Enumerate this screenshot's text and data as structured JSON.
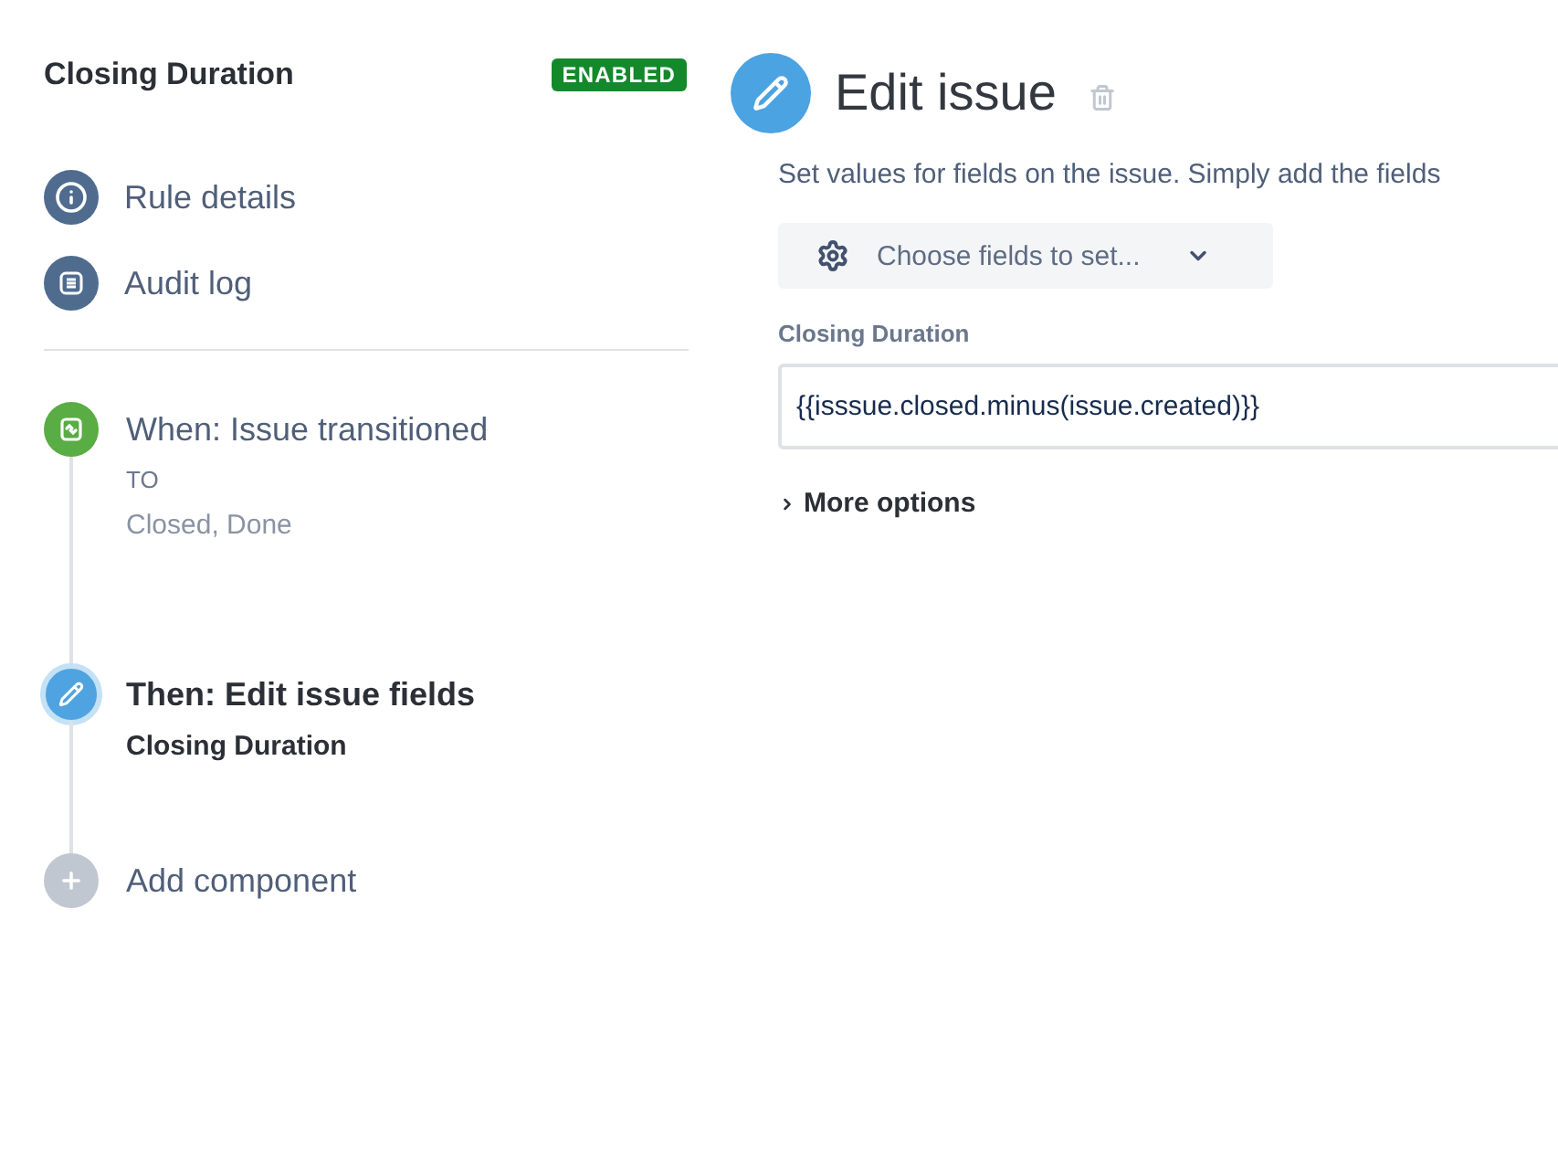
{
  "rule": {
    "title": "Closing Duration",
    "status": {
      "label": "ENABLED",
      "kind": "enabled"
    }
  },
  "nav": [
    {
      "label": "Rule details",
      "kind": "info"
    },
    {
      "label": "Audit log",
      "kind": "log"
    }
  ],
  "components": [
    {
      "kind": "trigger",
      "title": "When: Issue transitioned",
      "selected": false,
      "lines": [
        {
          "kind": "caption",
          "text": "TO"
        },
        {
          "kind": "value",
          "text": "Closed, Done"
        }
      ]
    },
    {
      "kind": "action",
      "title": "Then: Edit issue fields",
      "selected": true,
      "lines": [
        {
          "kind": "bold",
          "text": "Closing Duration"
        }
      ]
    }
  ],
  "add_component": {
    "label": "Add component"
  },
  "editor": {
    "title": "Edit issue",
    "description": "Set values for fields on the issue. Simply add the fields",
    "choose_button": "Choose fields to set...",
    "fields": [
      {
        "label": "Closing Duration",
        "value": "{{isssue.closed.minus(issue.created)}}"
      }
    ],
    "more_options": {
      "label": "More options",
      "expanded": false
    }
  }
}
